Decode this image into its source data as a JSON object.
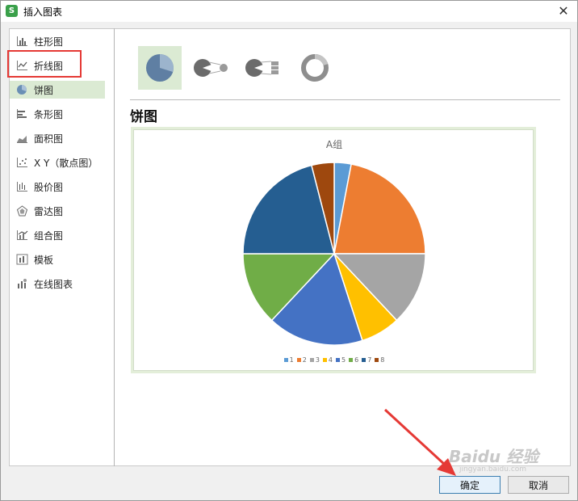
{
  "window": {
    "title": "插入图表",
    "app_icon": "S",
    "close_icon": "close-icon"
  },
  "sidebar": {
    "items": [
      {
        "label": "柱形图",
        "icon": "column-chart-icon"
      },
      {
        "label": "折线图",
        "icon": "line-chart-icon"
      },
      {
        "label": "饼图",
        "icon": "pie-chart-icon",
        "selected": true
      },
      {
        "label": "条形图",
        "icon": "bar-chart-icon"
      },
      {
        "label": "面积图",
        "icon": "area-chart-icon"
      },
      {
        "label": "X Y（散点图）",
        "icon": "scatter-chart-icon"
      },
      {
        "label": "股价图",
        "icon": "stock-chart-icon"
      },
      {
        "label": "雷达图",
        "icon": "radar-chart-icon"
      },
      {
        "label": "组合图",
        "icon": "combo-chart-icon"
      },
      {
        "label": "模板",
        "icon": "template-icon"
      },
      {
        "label": "在线图表",
        "icon": "online-chart-icon"
      }
    ]
  },
  "subtypes": [
    {
      "name": "pie",
      "icon": "pie-subtype-icon",
      "active": true
    },
    {
      "name": "pie-of-pie",
      "icon": "pie-of-pie-subtype-icon"
    },
    {
      "name": "bar-of-pie",
      "icon": "bar-of-pie-subtype-icon"
    },
    {
      "name": "doughnut",
      "icon": "doughnut-subtype-icon"
    }
  ],
  "section_title": "饼图",
  "chart_data": {
    "type": "pie",
    "title": "A组",
    "categories": [
      "1",
      "2",
      "3",
      "4",
      "5",
      "6",
      "7",
      "8"
    ],
    "values": [
      3,
      22,
      13,
      7,
      17,
      13,
      21,
      4
    ],
    "colors": [
      "#5b9bd5",
      "#ed7d31",
      "#a5a5a5",
      "#ffc000",
      "#4472c4",
      "#70ad47",
      "#255e91",
      "#9e480e"
    ],
    "legend_position": "bottom"
  },
  "buttons": {
    "ok": "确定",
    "cancel": "取消"
  },
  "watermark": {
    "text": "Baidu 经验",
    "sub": "jingyan.baidu.com"
  },
  "colors": {
    "selected_bg": "#dbead3",
    "annotation_red": "#e53935"
  }
}
